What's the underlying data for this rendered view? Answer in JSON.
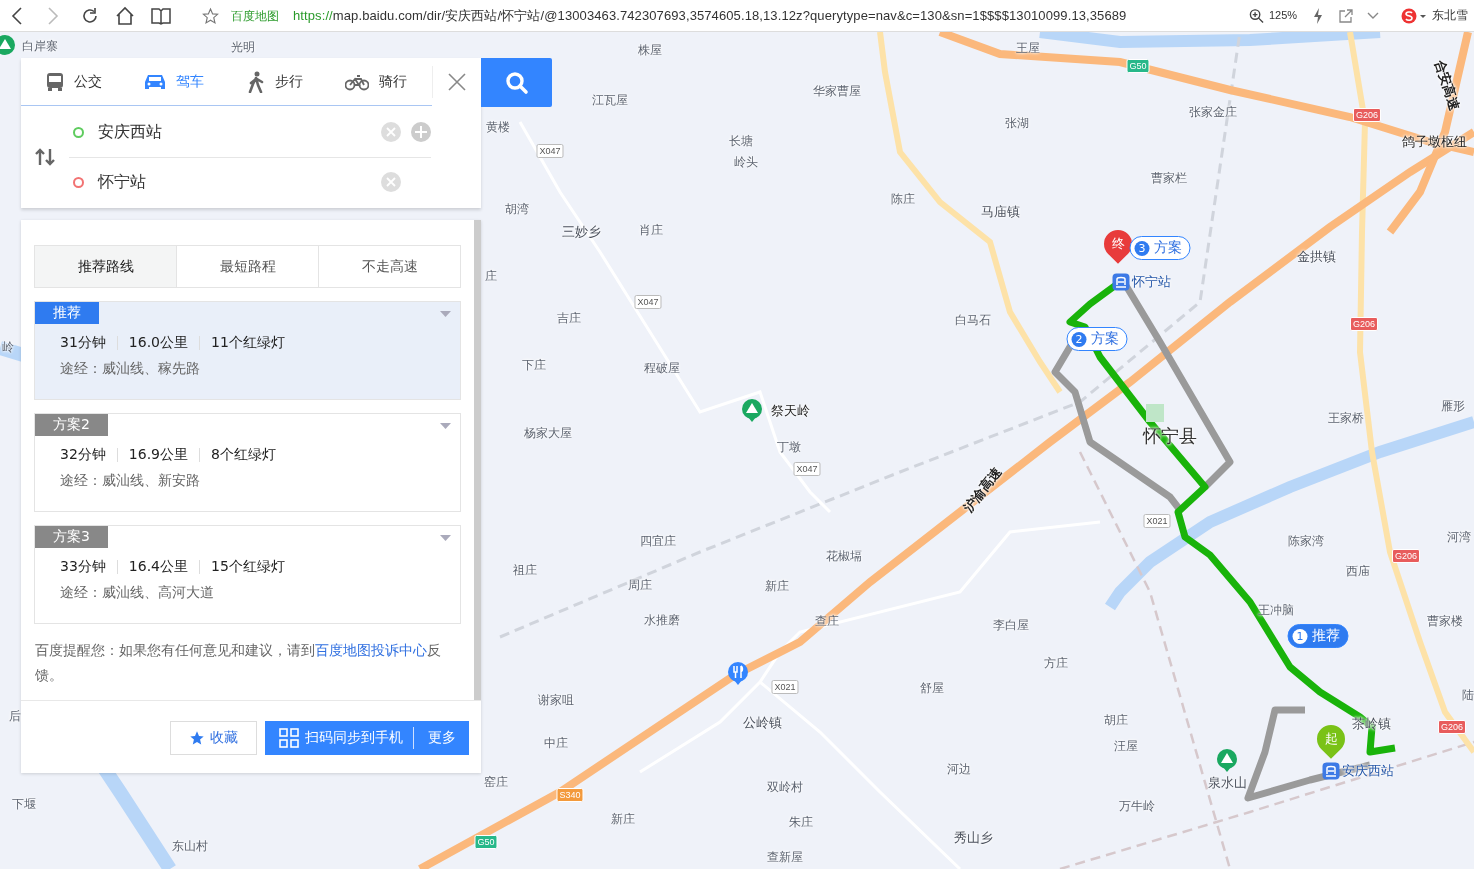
{
  "browser": {
    "site_name": "百度地图",
    "url": {
      "scheme": "https://",
      "rest": "map.baidu.com/dir/安庆西站/怀宁站/@13003463.742307693,3574605.18,13.12z?querytype=nav&c=130&sn=1$$$$13010099.13,35689"
    },
    "zoom": "125%",
    "account": "东北雪"
  },
  "route_panel": {
    "modes": [
      {
        "label": "公交",
        "kind": "bus",
        "selected": false
      },
      {
        "label": "驾车",
        "kind": "car",
        "selected": true
      },
      {
        "label": "步行",
        "kind": "walk",
        "selected": false
      },
      {
        "label": "骑行",
        "kind": "bike",
        "selected": false
      }
    ],
    "start": "安庆西站",
    "end": "怀宁站",
    "route_tabs": [
      {
        "label": "推荐路线",
        "selected": true
      },
      {
        "label": "最短路程",
        "selected": false
      },
      {
        "label": "不走高速",
        "selected": false
      }
    ],
    "plans": [
      {
        "tag": "推荐",
        "selected": true,
        "time": "31分钟",
        "distance": "16.0公里",
        "lights": "11个红绿灯",
        "via": "途经：威汕线、稼先路"
      },
      {
        "tag": "方案2",
        "selected": false,
        "time": "32分钟",
        "distance": "16.9公里",
        "lights": "8个红绿灯",
        "via": "途经：威汕线、新安路"
      },
      {
        "tag": "方案3",
        "selected": false,
        "time": "33分钟",
        "distance": "16.4公里",
        "lights": "15个红绿灯",
        "via": "途经：威汕线、高河大道"
      }
    ],
    "notice": {
      "text": "百度提醒您：如果您有任何意见和建议，请到",
      "link": "百度地图投诉中心",
      "tail": "反馈。"
    },
    "favorite_button": "收藏",
    "sync_button": "扫码同步到手机",
    "more_button": "更多"
  },
  "map": {
    "labels": [
      {
        "text": "白岸寨",
        "kind": "village"
      },
      {
        "text": "光明",
        "kind": "village"
      },
      {
        "text": "株屋",
        "kind": "village"
      },
      {
        "text": "王屋",
        "kind": "village"
      },
      {
        "text": "江瓦屋",
        "kind": "village"
      },
      {
        "text": "华家曹屋",
        "kind": "village"
      },
      {
        "text": "黄楼",
        "kind": "village"
      },
      {
        "text": "张湖",
        "kind": "village"
      },
      {
        "text": "张家金庄",
        "kind": "village"
      },
      {
        "text": "长塘",
        "kind": "village"
      },
      {
        "text": "岭头",
        "kind": "village"
      },
      {
        "text": "曹家栏",
        "kind": "village"
      },
      {
        "text": "陈庄",
        "kind": "village"
      },
      {
        "text": "马庙镇",
        "kind": "town"
      },
      {
        "text": "胡湾",
        "kind": "village"
      },
      {
        "text": "三妙乡",
        "kind": "town"
      },
      {
        "text": "肖庄",
        "kind": "village"
      },
      {
        "text": "金拱镇",
        "kind": "town"
      },
      {
        "text": "鸽子墩枢纽",
        "kind": "hub"
      },
      {
        "text": "合安高速",
        "kind": "highway"
      },
      {
        "text": "吉庄",
        "kind": "village"
      },
      {
        "text": "白马石",
        "kind": "village"
      },
      {
        "text": "下庄",
        "kind": "village"
      },
      {
        "text": "程破屋",
        "kind": "village"
      },
      {
        "text": "祭天岭",
        "kind": "hub"
      },
      {
        "text": "杨家大屋",
        "kind": "village"
      },
      {
        "text": "丁墩",
        "kind": "village"
      },
      {
        "text": "怀宁县",
        "kind": "county"
      },
      {
        "text": "王家桥",
        "kind": "village"
      },
      {
        "text": "雁形",
        "kind": "village"
      },
      {
        "text": "沪渝高速",
        "kind": "highway"
      },
      {
        "text": "四宜庄",
        "kind": "village"
      },
      {
        "text": "花椒塥",
        "kind": "village"
      },
      {
        "text": "陈家湾",
        "kind": "village"
      },
      {
        "text": "西庙",
        "kind": "village"
      },
      {
        "text": "河湾",
        "kind": "village"
      },
      {
        "text": "祖庄",
        "kind": "village"
      },
      {
        "text": "周庄",
        "kind": "village"
      },
      {
        "text": "新庄",
        "kind": "village"
      },
      {
        "text": "水推磨",
        "kind": "village"
      },
      {
        "text": "查庄",
        "kind": "village"
      },
      {
        "text": "李白屋",
        "kind": "village"
      },
      {
        "text": "王冲脑",
        "kind": "village"
      },
      {
        "text": "曹家楼",
        "kind": "village"
      },
      {
        "text": "方庄",
        "kind": "village"
      },
      {
        "text": "舒屋",
        "kind": "village"
      },
      {
        "text": "谢家咀",
        "kind": "village"
      },
      {
        "text": "公岭镇",
        "kind": "town"
      },
      {
        "text": "胡庄",
        "kind": "village"
      },
      {
        "text": "茶岭镇",
        "kind": "town"
      },
      {
        "text": "中庄",
        "kind": "village"
      },
      {
        "text": "汪屋",
        "kind": "village"
      },
      {
        "text": "河边",
        "kind": "village"
      },
      {
        "text": "窑庄",
        "kind": "village"
      },
      {
        "text": "双岭村",
        "kind": "village"
      },
      {
        "text": "泉水山",
        "kind": "town"
      },
      {
        "text": "万牛岭",
        "kind": "village"
      },
      {
        "text": "新庄",
        "kind": "village"
      },
      {
        "text": "朱庄",
        "kind": "village"
      },
      {
        "text": "秀山乡",
        "kind": "town"
      },
      {
        "text": "东山村",
        "kind": "village"
      },
      {
        "text": "下堰",
        "kind": "village"
      },
      {
        "text": "查新屋",
        "kind": "village"
      },
      {
        "text": "岭",
        "kind": "village"
      },
      {
        "text": "后",
        "kind": "village"
      },
      {
        "text": "陆",
        "kind": "village"
      },
      {
        "text": "庄",
        "kind": "village"
      }
    ],
    "shields": [
      {
        "text": "G50",
        "kind": "expressway"
      },
      {
        "text": "G206",
        "kind": "national"
      },
      {
        "text": "G206",
        "kind": "national"
      },
      {
        "text": "G206",
        "kind": "national"
      },
      {
        "text": "G206",
        "kind": "national"
      },
      {
        "text": "X047",
        "kind": "county"
      },
      {
        "text": "X047",
        "kind": "county"
      },
      {
        "text": "X047",
        "kind": "county"
      },
      {
        "text": "X021",
        "kind": "county"
      },
      {
        "text": "X021",
        "kind": "county"
      },
      {
        "text": "S340",
        "kind": "provincial"
      },
      {
        "text": "G50",
        "kind": "expressway"
      }
    ],
    "stations": [
      {
        "text": "怀宁站"
      },
      {
        "text": "安庆西站"
      }
    ],
    "route_callouts": [
      {
        "number": "3",
        "label": "方案",
        "selected": false
      },
      {
        "number": "2",
        "label": "方案",
        "selected": false
      },
      {
        "number": "1",
        "label": "推荐",
        "selected": true
      }
    ],
    "end_marker": "终",
    "start_marker": "起"
  }
}
